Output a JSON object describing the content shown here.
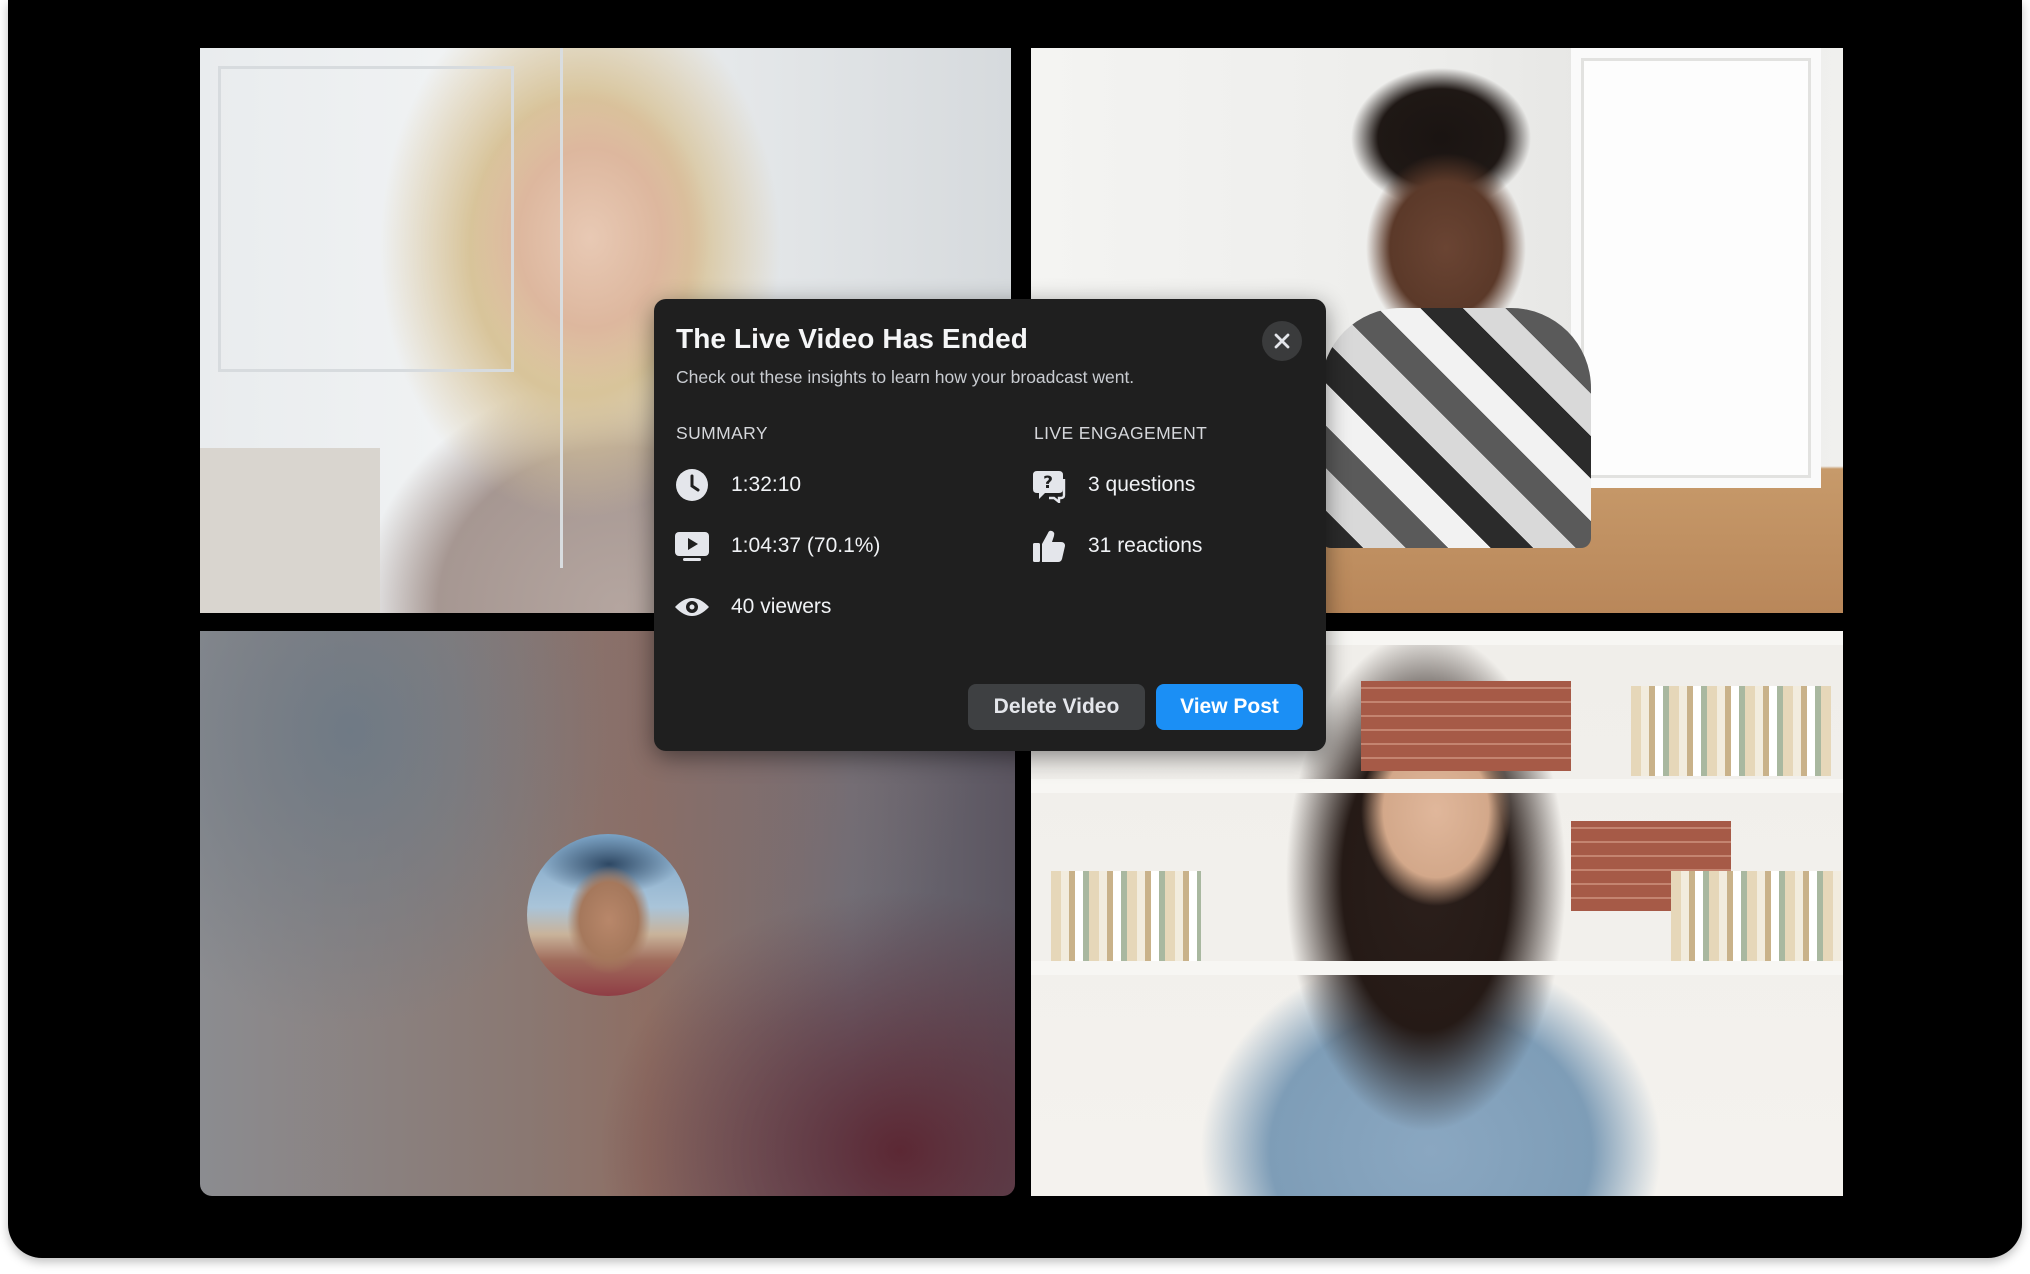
{
  "modal": {
    "title": "The Live Video Has Ended",
    "subtitle": "Check out these insights to learn how your broadcast went.",
    "summary": {
      "label": "SUMMARY",
      "items": [
        {
          "icon": "clock-icon",
          "text": "1:32:10"
        },
        {
          "icon": "play-icon",
          "text": "1:04:37 (70.1%)"
        },
        {
          "icon": "eye-icon",
          "text": "40 viewers"
        }
      ]
    },
    "engagement": {
      "label": "LIVE ENGAGEMENT",
      "items": [
        {
          "icon": "question-bubble-icon",
          "text": "3 questions"
        },
        {
          "icon": "thumbs-up-icon",
          "text": "31 reactions"
        }
      ]
    },
    "buttons": {
      "delete": "Delete Video",
      "view": "View Post"
    },
    "close_icon": "close-icon"
  },
  "colors": {
    "modal_bg": "#1f1f1f",
    "primary_button": "#1b8ff5",
    "secondary_button": "#3e4042",
    "frame": "#000000"
  }
}
